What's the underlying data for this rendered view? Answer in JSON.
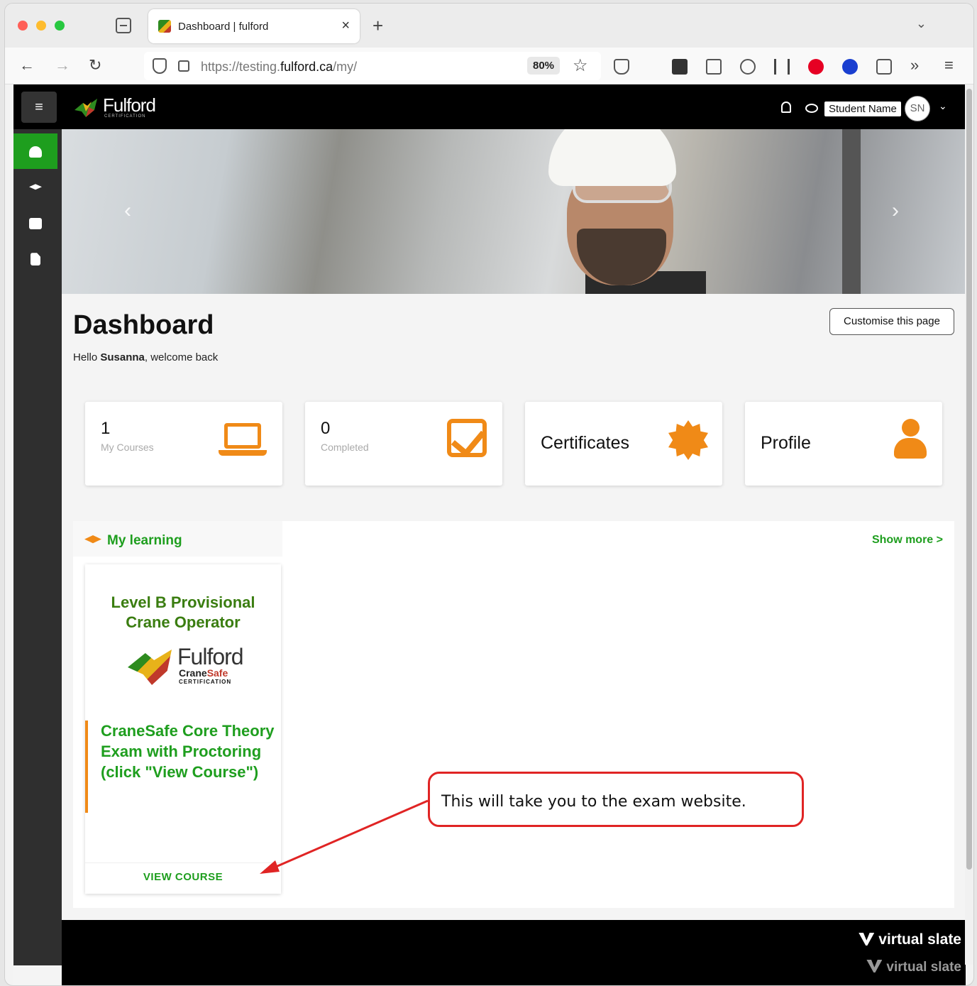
{
  "browser": {
    "tab_title": "Dashboard | fulford",
    "url_prefix": "https://testing.",
    "url_domain": "fulford.ca",
    "url_path": "/my/",
    "zoom": "80%"
  },
  "site": {
    "brand": "Fulford",
    "brand_sub": "CERTIFICATION",
    "user_name": "Student Name",
    "avatar_initials": "SN"
  },
  "dashboard": {
    "title": "Dashboard",
    "welcome_prefix": "Hello ",
    "welcome_name": "Susanna",
    "welcome_suffix": ", welcome back",
    "customise_label": "Customise this page"
  },
  "cards": [
    {
      "value": "1",
      "label": "My Courses",
      "icon": "laptop-icon"
    },
    {
      "value": "0",
      "label": "Completed",
      "icon": "check-square-icon"
    },
    {
      "label": "Certificates",
      "icon": "certificate-icon"
    },
    {
      "label": "Profile",
      "icon": "user-icon"
    }
  ],
  "learning": {
    "title": "My learning",
    "show_more": "Show more >",
    "course": {
      "title_line1": "Level B Provisional",
      "title_line2": "Crane Operator",
      "logo_text": "Fulford",
      "logo_sub_a": "Crane",
      "logo_sub_b": "Safe",
      "logo_cert": "CERTIFICATION",
      "description": "CraneSafe Core Theory Exam with Proctoring (click \"View Course\")",
      "action": "VIEW COURSE"
    }
  },
  "footer": {
    "brand": "virtual slate"
  },
  "annotation": {
    "text": "This will take you to the exam website."
  },
  "colors": {
    "accent_green": "#1e9e1e",
    "accent_orange": "#f08a17",
    "callout_red": "#e02424"
  }
}
